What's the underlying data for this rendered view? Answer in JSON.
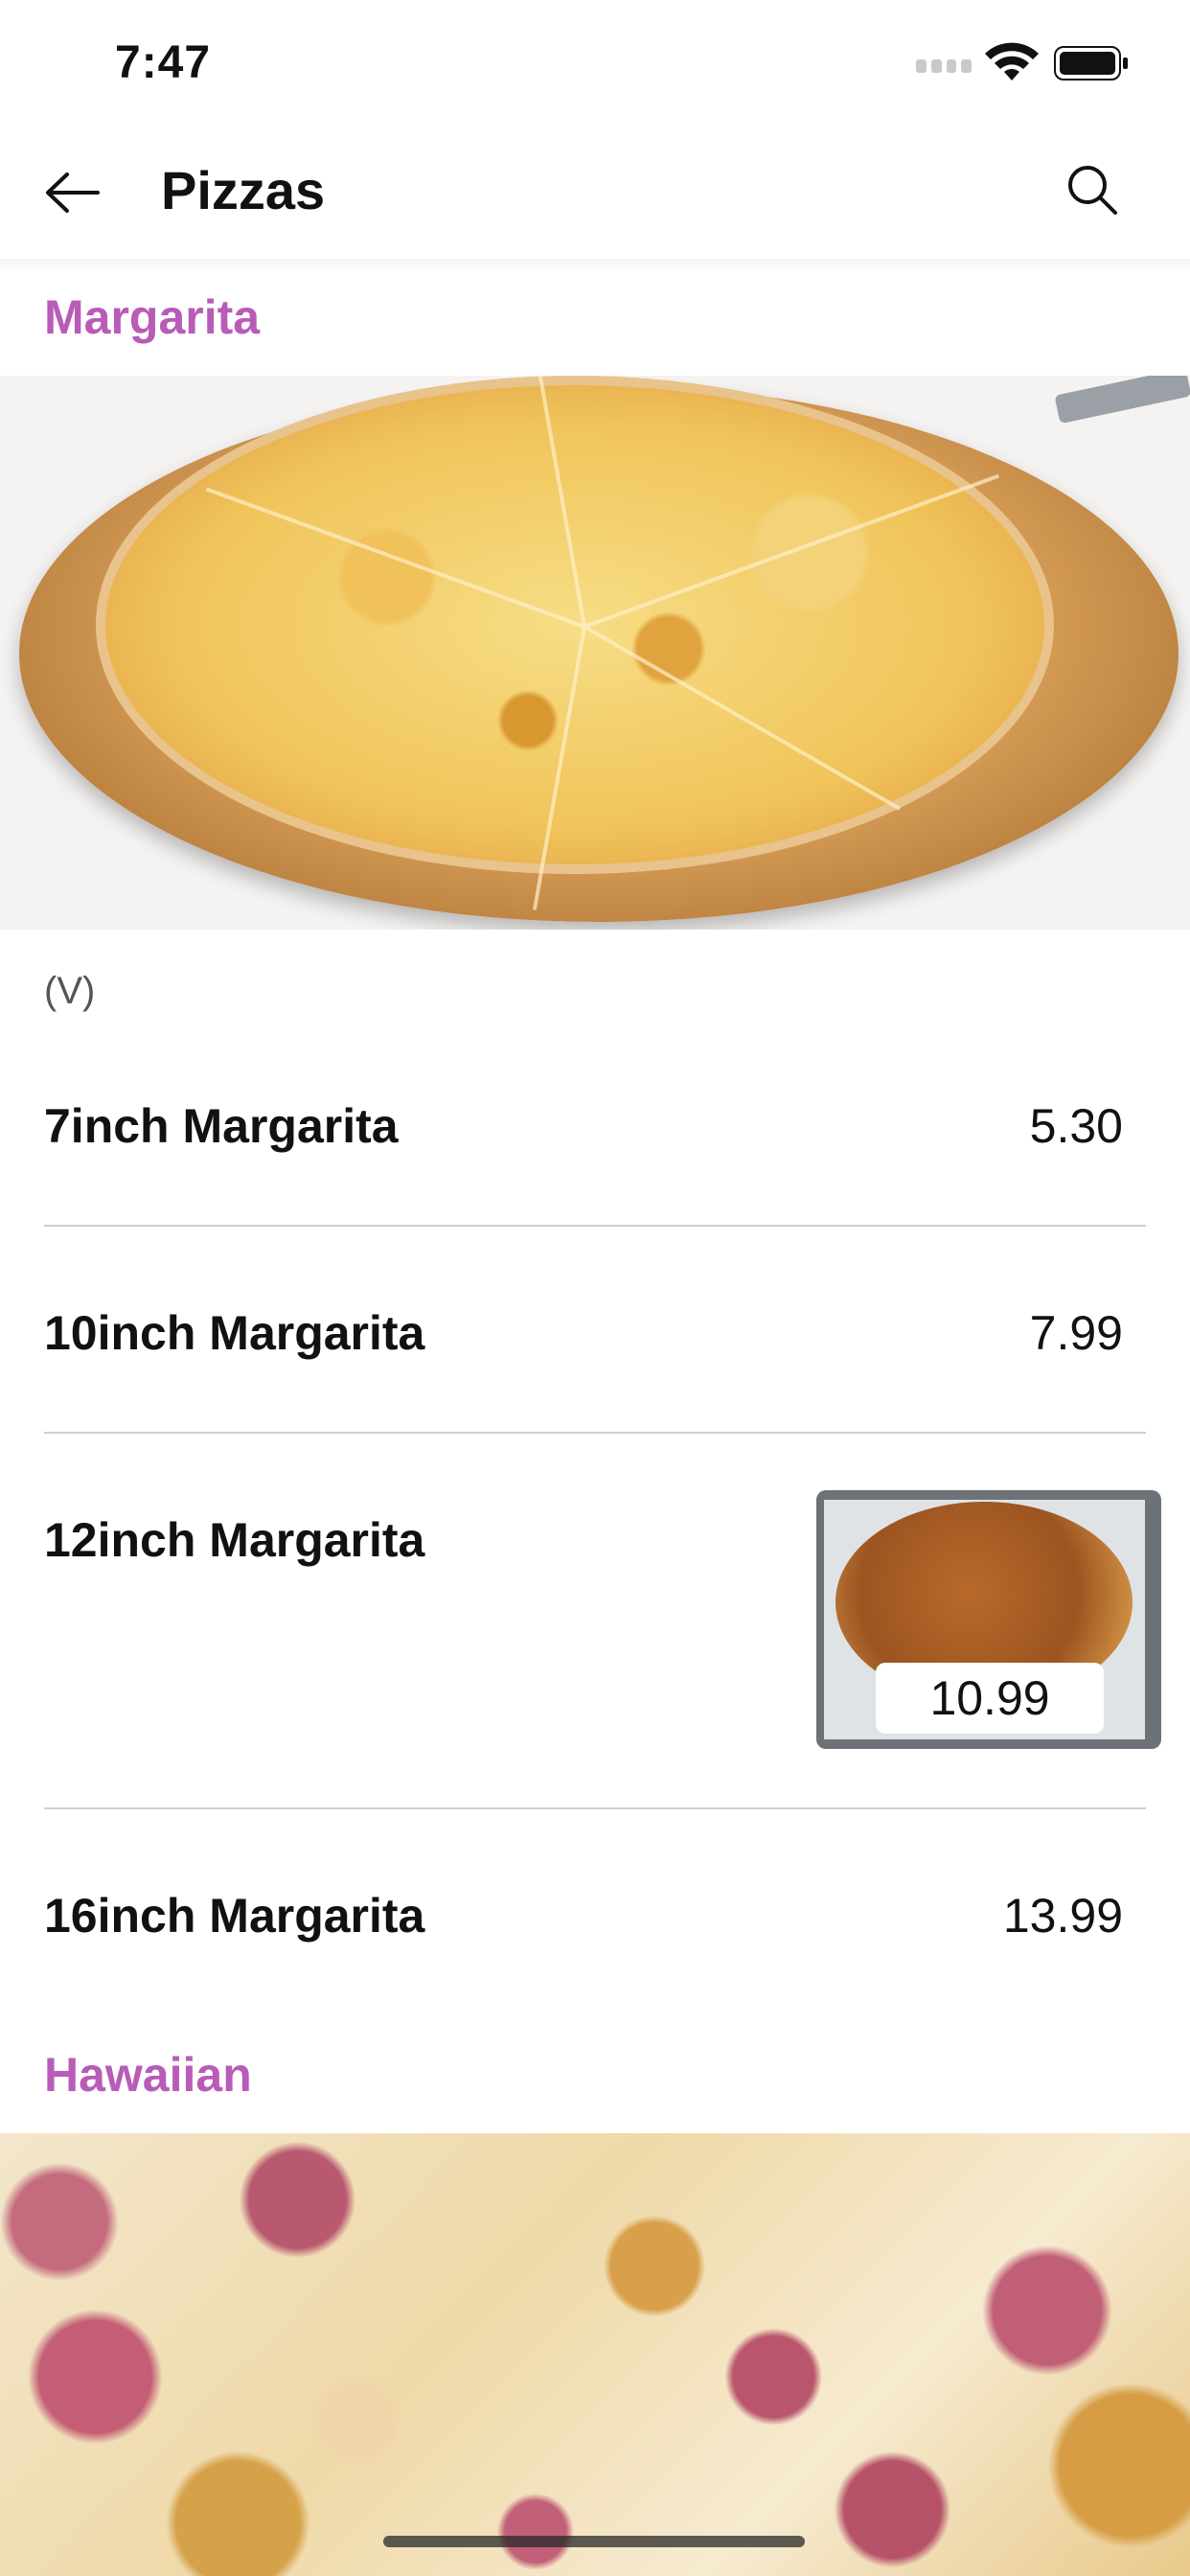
{
  "status_bar": {
    "time": "7:47"
  },
  "header": {
    "title": "Pizzas"
  },
  "sections": [
    {
      "title": "Margarita",
      "note": "(V)",
      "items": [
        {
          "label": "7inch Margarita",
          "price": "5.30"
        },
        {
          "label": "10inch Margarita",
          "price": "7.99"
        },
        {
          "label": "12inch Margarita",
          "price": "10.99"
        },
        {
          "label": "16inch Margarita",
          "price": "13.99"
        }
      ]
    },
    {
      "title": "Hawaiian"
    }
  ],
  "colors": {
    "accent": "#b85cb8",
    "divider": "#cfcfcf"
  },
  "icons": {
    "back": "arrow-left-icon",
    "search": "search-icon"
  }
}
